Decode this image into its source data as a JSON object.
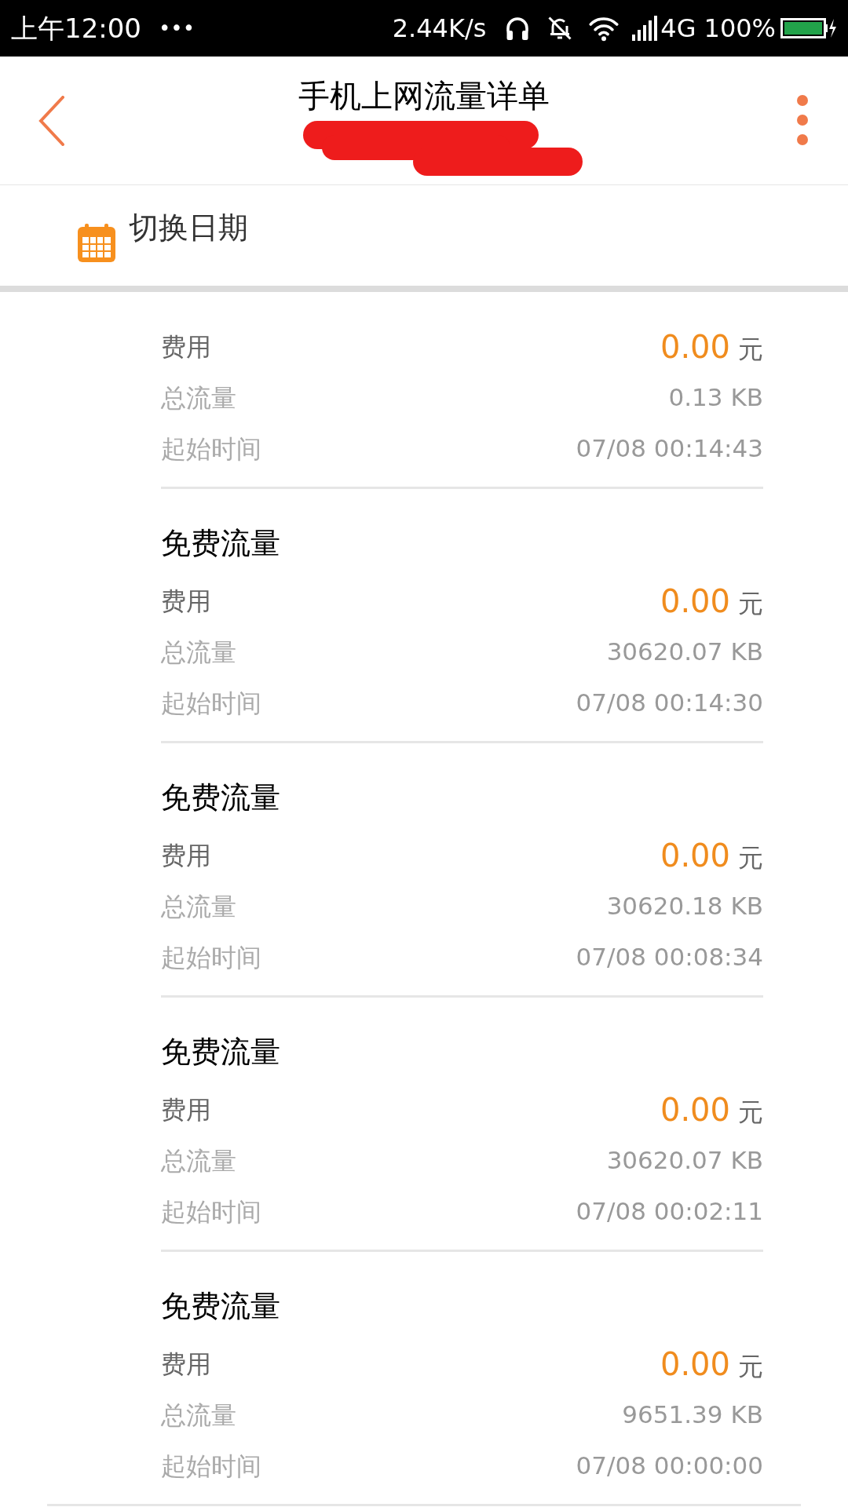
{
  "status_bar": {
    "time": "上午12:00",
    "more": "•••",
    "speed": "2.44K/s",
    "network": "4G",
    "battery": "100%"
  },
  "header": {
    "title": "手机上网流量详单"
  },
  "date_switch": {
    "label": "切换日期"
  },
  "records": [
    {
      "rows": [
        {
          "kind": "cost",
          "label": "费用",
          "value": "0.00",
          "unit": "元"
        },
        {
          "kind": "plain",
          "label": "总流量",
          "value": "0.13 KB"
        },
        {
          "kind": "plain",
          "label": "起始时间",
          "value": "07/08 00:14:43"
        }
      ]
    },
    {
      "title": "免费流量",
      "rows": [
        {
          "kind": "cost",
          "label": "费用",
          "value": "0.00",
          "unit": "元"
        },
        {
          "kind": "plain",
          "label": "总流量",
          "value": "30620.07 KB"
        },
        {
          "kind": "plain",
          "label": "起始时间",
          "value": "07/08 00:14:30"
        }
      ]
    },
    {
      "title": "免费流量",
      "rows": [
        {
          "kind": "cost",
          "label": "费用",
          "value": "0.00",
          "unit": "元"
        },
        {
          "kind": "plain",
          "label": "总流量",
          "value": "30620.18 KB"
        },
        {
          "kind": "plain",
          "label": "起始时间",
          "value": "07/08 00:08:34"
        }
      ]
    },
    {
      "title": "免费流量",
      "rows": [
        {
          "kind": "cost",
          "label": "费用",
          "value": "0.00",
          "unit": "元"
        },
        {
          "kind": "plain",
          "label": "总流量",
          "value": "30620.07 KB"
        },
        {
          "kind": "plain",
          "label": "起始时间",
          "value": "07/08 00:02:11"
        }
      ]
    },
    {
      "title": "免费流量",
      "rows": [
        {
          "kind": "cost",
          "label": "费用",
          "value": "0.00",
          "unit": "元"
        },
        {
          "kind": "plain",
          "label": "总流量",
          "value": "9651.39 KB"
        },
        {
          "kind": "plain",
          "label": "起始时间",
          "value": "07/08 00:00:00"
        }
      ]
    }
  ]
}
